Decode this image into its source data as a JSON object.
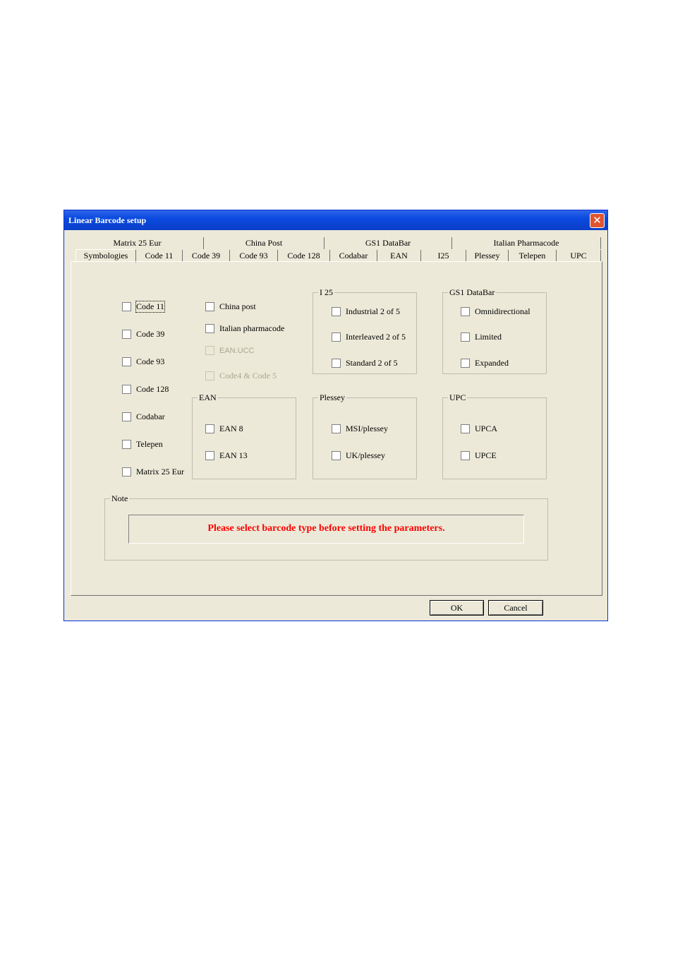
{
  "window": {
    "title": "Linear Barcode setup"
  },
  "tabs_row1": [
    "Matrix 25 Eur",
    "China Post",
    "GS1 DataBar",
    "Italian Pharmacode"
  ],
  "tabs_row2": [
    "Symbologies",
    "Code 11",
    "Code 39",
    "Code 93",
    "Code 128",
    "Codabar",
    "EAN",
    "I25",
    "Plessey",
    "Telepen",
    "UPC"
  ],
  "active_tab": "Symbologies",
  "left_column": [
    {
      "label": "Code 11",
      "checked": false,
      "focused": true
    },
    {
      "label": "Code 39",
      "checked": false
    },
    {
      "label": "Code 93",
      "checked": false
    },
    {
      "label": "Code 128",
      "checked": false
    },
    {
      "label": "Codabar",
      "checked": false
    },
    {
      "label": "Telepen",
      "checked": false
    },
    {
      "label": "Matrix 25 Eur",
      "checked": false
    }
  ],
  "middle_column": [
    {
      "label": "China post",
      "checked": false,
      "enabled": true
    },
    {
      "label": "Italian pharmacode",
      "checked": false,
      "enabled": true
    },
    {
      "label": "EAN.UCC",
      "checked": false,
      "enabled": false
    },
    {
      "label": "Code4 & Code 5",
      "checked": false,
      "enabled": false
    }
  ],
  "groups": {
    "i25": {
      "title": "I 25",
      "items": [
        "Industrial 2 of 5",
        "Interleaved 2 of 5",
        "Standard 2 of 5"
      ]
    },
    "gs1": {
      "title": "GS1 DataBar",
      "items": [
        "Omnidirectional",
        "Limited",
        "Expanded"
      ]
    },
    "ean": {
      "title": "EAN",
      "items": [
        "EAN 8",
        "EAN 13"
      ]
    },
    "plessey": {
      "title": "Plessey",
      "items": [
        "MSI/plessey",
        "UK/plessey"
      ]
    },
    "upc": {
      "title": "UPC",
      "items": [
        "UPCA",
        "UPCE"
      ]
    }
  },
  "note": {
    "title": "Note",
    "message": "Please select barcode type before setting the parameters.",
    "message_color": "#ff0000"
  },
  "buttons": {
    "ok": "OK",
    "cancel": "Cancel"
  },
  "icons": {
    "close": "close-icon"
  },
  "colors": {
    "titlebar": "#0b4ae0",
    "dialog_bg": "#ece9d8",
    "close_button": "#e0552f"
  }
}
